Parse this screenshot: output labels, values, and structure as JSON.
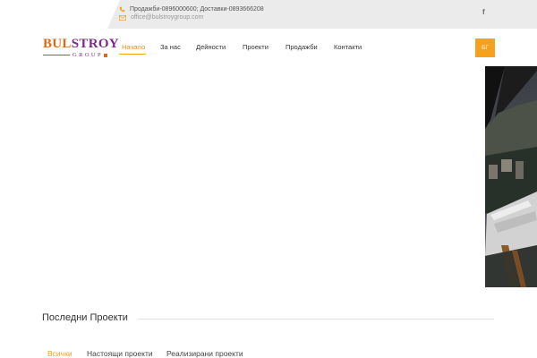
{
  "topbar": {
    "phone_text": "Продажби-0896000600; Доставки-0893666208",
    "email_text": "office@bulstroygroup.com",
    "facebook_label": "f"
  },
  "logo": {
    "part1": "BUL",
    "part2": "STROY",
    "sub": "GROUP"
  },
  "nav": {
    "items": [
      {
        "label": "Начало",
        "active": true
      },
      {
        "label": "За нас",
        "active": false
      },
      {
        "label": "Дейности",
        "active": false
      },
      {
        "label": "Проекти",
        "active": false
      },
      {
        "label": "Продажби",
        "active": false
      },
      {
        "label": "Контакти",
        "active": false
      }
    ],
    "language_label": "БГ"
  },
  "section": {
    "title": "Последни Проекти"
  },
  "filters": {
    "items": [
      {
        "label": "Всички",
        "active": true
      },
      {
        "label": "Настоящи проекти",
        "active": false
      },
      {
        "label": "Реализирани проекти",
        "active": false
      }
    ]
  },
  "colors": {
    "accent": "#f0a526",
    "logo_orange": "#d96a1c",
    "logo_purple": "#7b2d86",
    "topbar_bg": "#ebebeb"
  }
}
